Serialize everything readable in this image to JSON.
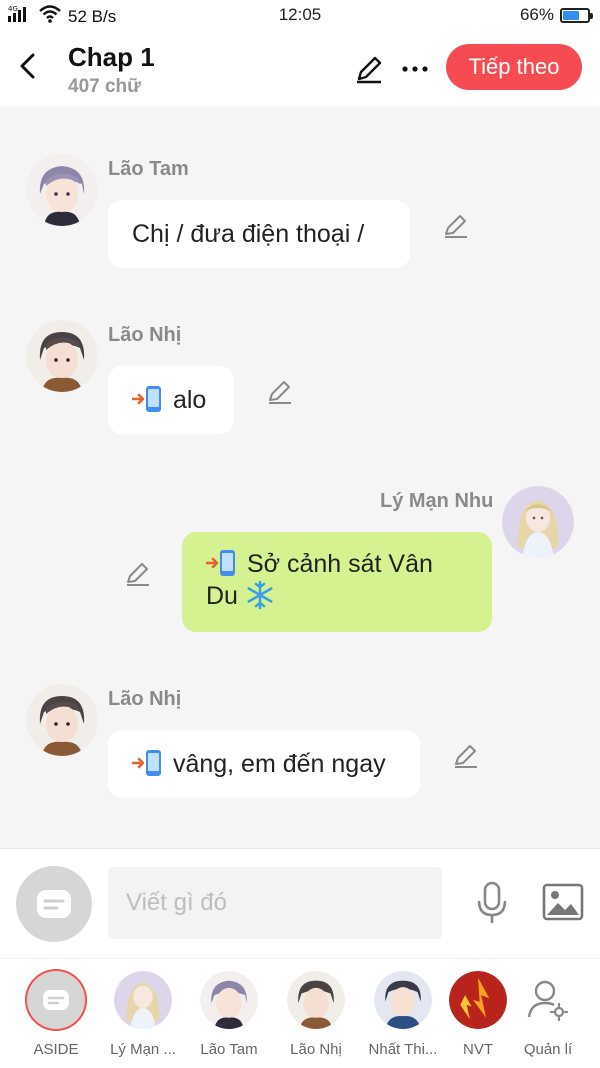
{
  "status_bar": {
    "signal": "4G",
    "speed": "52 B/s",
    "time": "12:05",
    "battery_text": "66%",
    "battery_level": 0.66
  },
  "header": {
    "title": "Chap 1",
    "word_count": "407 chữ",
    "next_label": "Tiếp theo",
    "accent": "#f54b51"
  },
  "messages": [
    {
      "speaker": "Lão Tam",
      "text": "Chị / đưa điện thoại /",
      "side": "left"
    },
    {
      "speaker": "Lão Nhị",
      "text": "alo",
      "prefix_icon": "phone-call-icon",
      "side": "left"
    },
    {
      "speaker": "Lý Mạn Nhu",
      "text_line1": "Sở cảnh sát Vân",
      "text_line2": "Du",
      "prefix_icon": "phone-call-icon",
      "suffix_icon": "snowflake-icon",
      "side": "right",
      "bubble_color": "#d5f291"
    },
    {
      "speaker": "Lão Nhị",
      "text": "vâng, em đến ngay",
      "prefix_icon": "phone-call-icon",
      "side": "left"
    }
  ],
  "composer": {
    "placeholder": "Viết gì đó"
  },
  "characters": [
    {
      "label": "ASIDE"
    },
    {
      "label": "Lý Mạn ..."
    },
    {
      "label": "Lão Tam"
    },
    {
      "label": "Lão Nhị"
    },
    {
      "label": "Nhất Thi..."
    },
    {
      "label": "NVT"
    },
    {
      "label": "Quản lí"
    }
  ]
}
